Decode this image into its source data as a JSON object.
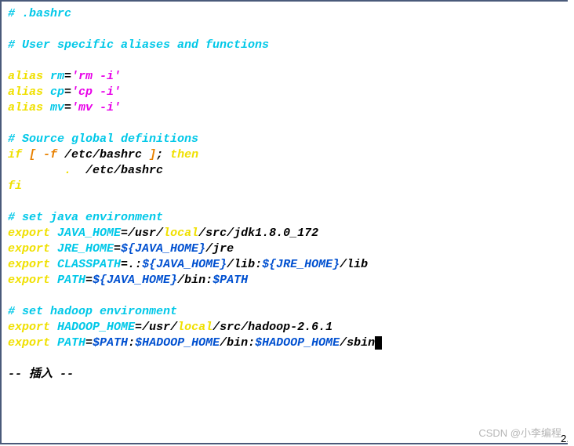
{
  "l1": {
    "a": "# .bashrc"
  },
  "l2": {
    "a": "# User specific aliases and functions"
  },
  "l3": {
    "a": "alias ",
    "b": "rm",
    "c": "=",
    "d": "'rm -i'"
  },
  "l4": {
    "a": "alias ",
    "b": "cp",
    "c": "=",
    "d": "'cp -i'"
  },
  "l5": {
    "a": "alias ",
    "b": "mv",
    "c": "=",
    "d": "'mv -i'"
  },
  "l6": {
    "a": "# Source global definitions"
  },
  "l7": {
    "a": "if ",
    "b": "[ ",
    "c": "-f ",
    "d": "/etc/bashrc",
    "e": " ]",
    "f": "; ",
    "g": "then"
  },
  "l8": {
    "a": "        ",
    "b": ". ",
    "c": " /etc/bashrc"
  },
  "l9": {
    "a": "fi"
  },
  "l10": {
    "a": "# set java environment"
  },
  "l11": {
    "a": "export ",
    "b": "JAVA_HOME",
    "c": "=",
    "d": "/usr/",
    "e": "local",
    "f": "/src/jdk1.8.0_172"
  },
  "l12": {
    "a": "export ",
    "b": "JRE_HOME",
    "c": "=",
    "d": "${JAVA_HOME}",
    "e": "/jre"
  },
  "l13": {
    "a": "export ",
    "b": "CLASSPATH",
    "c": "=",
    "d": ".:",
    "e": "${JAVA_HOME}",
    "f": "/lib:",
    "g": "${JRE_HOME}",
    "h": "/lib"
  },
  "l14": {
    "a": "export ",
    "b": "PATH",
    "c": "=",
    "d": "${JAVA_HOME}",
    "e": "/bin:",
    "f": "$PATH"
  },
  "l15": {
    "a": "# set hadoop environment"
  },
  "l16": {
    "a": "export ",
    "b": "HADOOP_HOME",
    "c": "=",
    "d": "/usr/",
    "e": "local",
    "f": "/src/hadoop-2.6.1"
  },
  "l17": {
    "a": "export ",
    "b": "PATH",
    "c": "=",
    "d": "$PATH",
    "e": ":",
    "f": "$HADOOP_HOME",
    "g": "/bin:",
    "h": "$HADOOP_HOME",
    "i": "/sbin"
  },
  "l18": {
    "a": "-- 插入 --"
  },
  "watermark": "CSDN @小李编程",
  "corner": "2."
}
